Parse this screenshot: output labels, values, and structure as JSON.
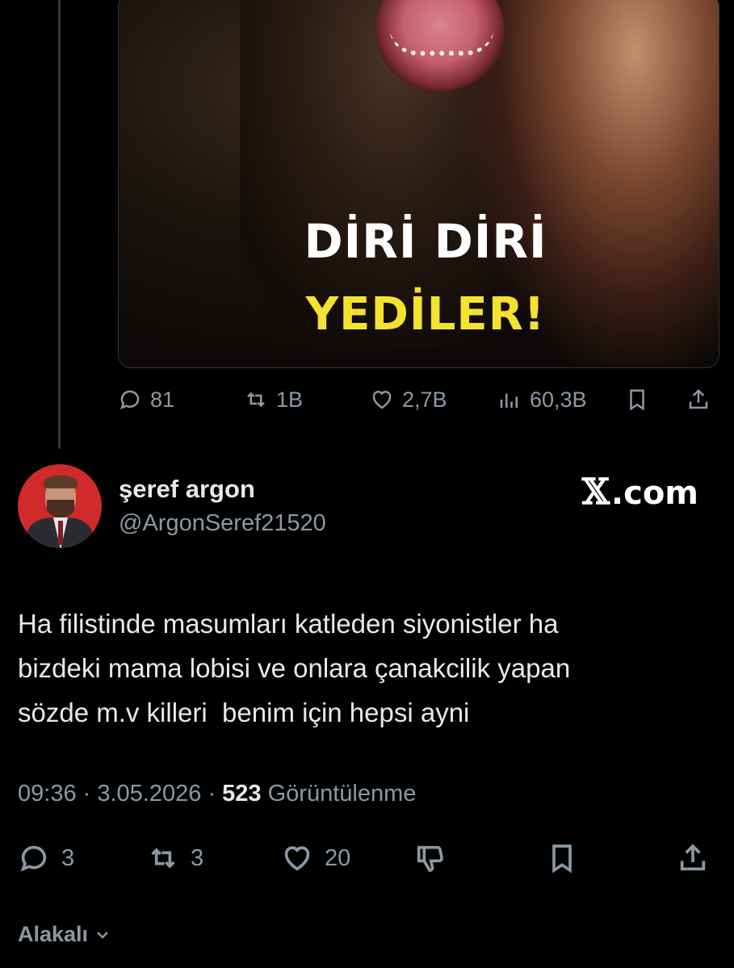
{
  "quoted_post": {
    "image_headline_line1": "DİRİ DİRİ",
    "image_headline_line2": "YEDİLER!",
    "stats": {
      "replies": "81",
      "reposts": "1B",
      "likes": "2,7B",
      "views": "60,3B"
    }
  },
  "author": {
    "name": "şeref argon",
    "handle": "@ArgonSeref21520"
  },
  "brand": {
    "mark": "𝕏",
    "text": ".com"
  },
  "post": {
    "lines": [
      "Ha filistinde masumları katleden siyonistler ha",
      "bizdeki mama lobisi ve onlara çanakcilik yapan",
      "sözde m.v killeri  benim için hepsi ayni"
    ],
    "time": "09:36",
    "date": "3.05.2026",
    "views_count": "523",
    "views_label": "Görüntülenme"
  },
  "actions": {
    "replies": "3",
    "reposts": "3",
    "likes": "20"
  },
  "sort": {
    "label": "Alakalı"
  },
  "colors": {
    "background": "#000000",
    "text": "#e7e9ea",
    "muted": "#8b98a5",
    "headline_yellow": "#f3e22e"
  }
}
